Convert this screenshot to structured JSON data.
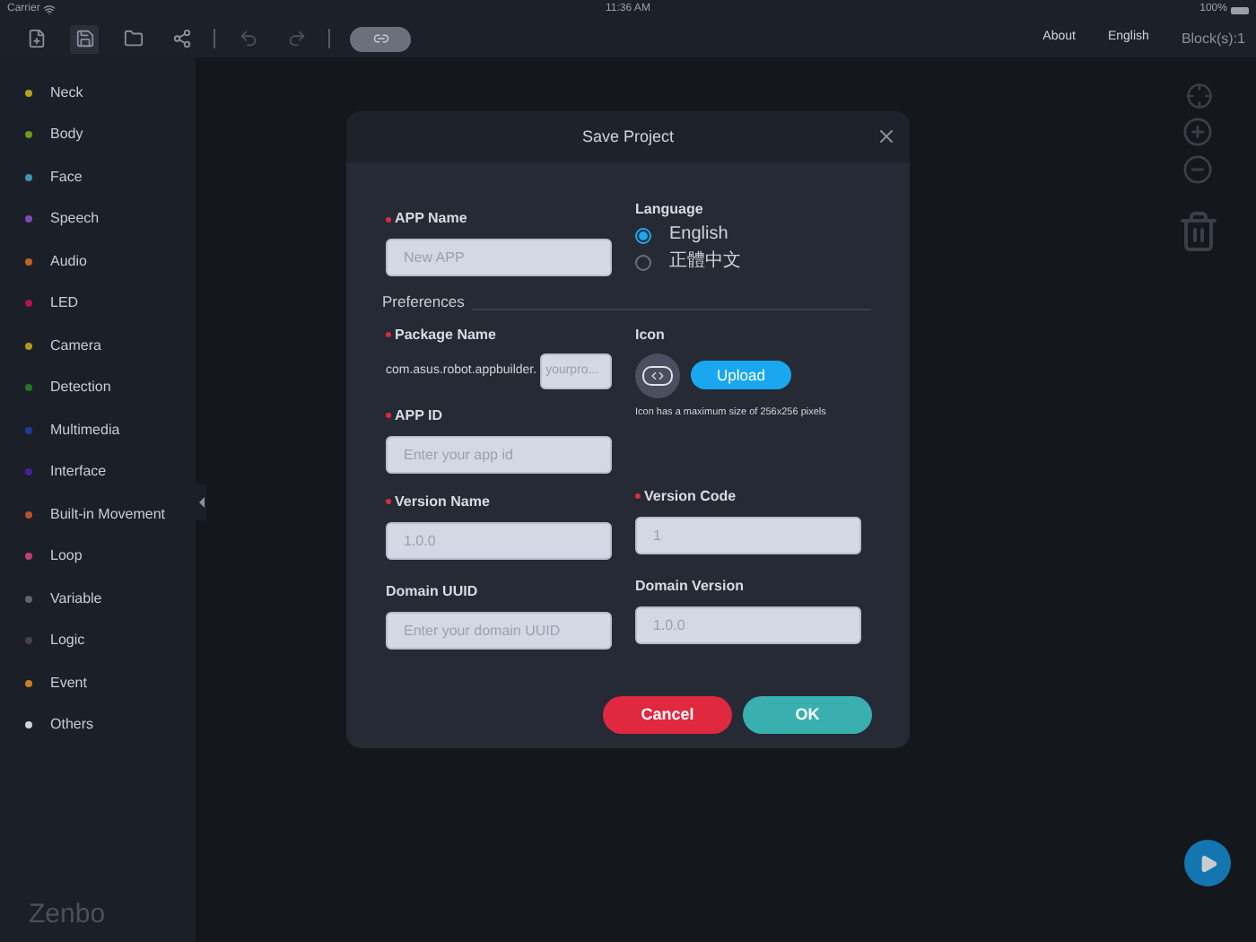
{
  "status_bar": {
    "carrier": "Carrier",
    "time": "11:36 AM",
    "battery": "100%"
  },
  "toolbar": {
    "link_toggle": {
      "on": true
    },
    "links": [
      {
        "label": "About"
      },
      {
        "label": "English"
      }
    ],
    "block_count": "Block(s):1"
  },
  "sidebar": {
    "items": [
      {
        "label": "Neck",
        "color": "#b5a21c"
      },
      {
        "label": "Body",
        "color": "#6e9a1e"
      },
      {
        "label": "Face",
        "color": "#3a97b0"
      },
      {
        "label": "Speech",
        "color": "#7b4bb8"
      },
      {
        "label": "Audio",
        "color": "#c0651c"
      },
      {
        "label": "LED",
        "color": "#b8124c"
      },
      {
        "label": "Camera",
        "color": "#b39a12"
      },
      {
        "label": "Detection",
        "color": "#1e7a22"
      },
      {
        "label": "Multimedia",
        "color": "#1e3a9a"
      },
      {
        "label": "Interface",
        "color": "#4a1e9a"
      },
      {
        "label": "Built-in Movement",
        "color": "#b8502e"
      },
      {
        "label": "Loop",
        "color": "#c03e78"
      },
      {
        "label": "Variable",
        "color": "#5e6472"
      },
      {
        "label": "Logic",
        "color": "#4a3e48"
      },
      {
        "label": "Event",
        "color": "#c7801c"
      },
      {
        "label": "Others",
        "color": "#d0d2d6"
      }
    ],
    "logo": "Zenbo"
  },
  "dialog": {
    "title": "Save Project",
    "app_name": {
      "label": "APP Name",
      "required": true,
      "placeholder": "New APP"
    },
    "language": {
      "label": "Language",
      "options": [
        {
          "label": "English",
          "selected": true
        },
        {
          "label": "正體中文",
          "selected": false
        }
      ]
    },
    "preferences_heading": "Preferences",
    "package_name": {
      "label": "Package Name",
      "required": true,
      "prefix": "com.asus.robot.appbuilder.",
      "placeholder": "yourpro..."
    },
    "icon": {
      "label": "Icon",
      "button": "Upload",
      "hint": "Icon has a maximum size of 256x256 pixels"
    },
    "app_id": {
      "label": "APP ID",
      "required": true,
      "placeholder": "Enter your app id"
    },
    "version_name": {
      "label": "Version Name",
      "required": true,
      "placeholder": "1.0.0"
    },
    "version_code": {
      "label": "Version Code",
      "required": true,
      "placeholder": "1"
    },
    "domain_uuid": {
      "label": "Domain UUID",
      "required": false,
      "placeholder": "Enter your domain UUID"
    },
    "domain_version": {
      "label": "Domain Version",
      "required": false,
      "placeholder": "1.0.0"
    },
    "buttons": [
      {
        "kind": "cancel",
        "label": "Cancel"
      },
      {
        "kind": "ok",
        "label": "OK"
      }
    ]
  }
}
